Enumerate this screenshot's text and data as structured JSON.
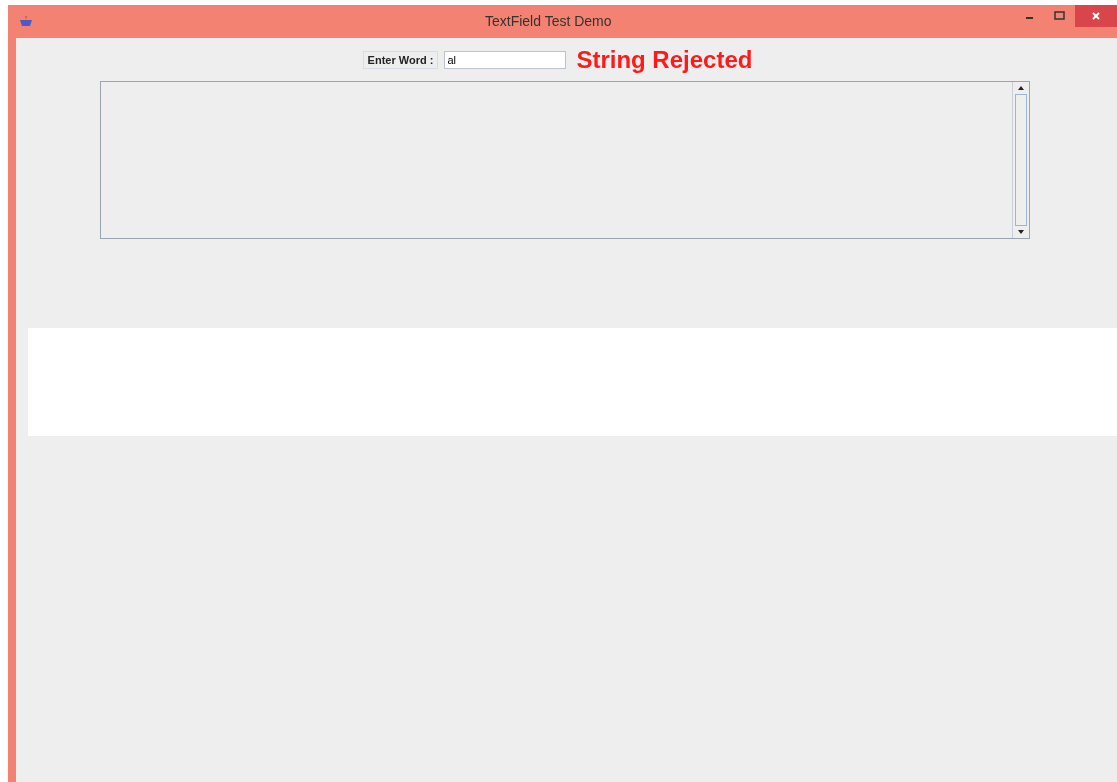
{
  "window": {
    "title": "TextField Test Demo"
  },
  "form": {
    "label": "Enter Word :",
    "value": "al",
    "status": "String Rejected"
  }
}
